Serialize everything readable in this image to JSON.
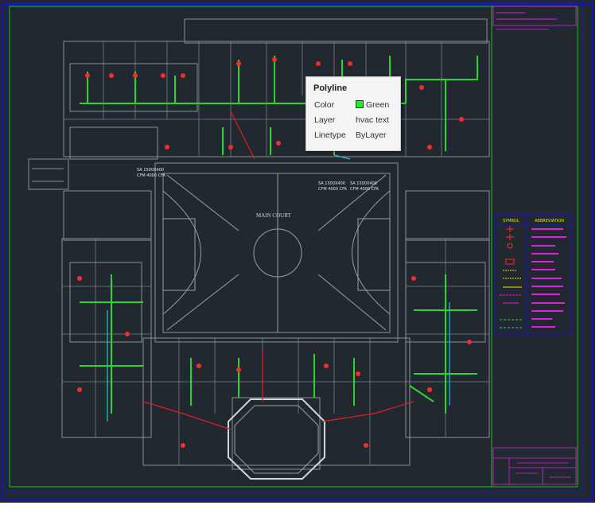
{
  "drawing": {
    "court_label": "MAIN COURT",
    "tag_a_line1": "SA 1500X400",
    "tag_a_line2": "CFM 4000 CFA",
    "tag_b_line1": "SA 1500X400",
    "tag_b_line2": "CFM 4000 CFA",
    "tag_c_line1": "SA 1500X400",
    "tag_c_line2": "CFM 4000 CFA"
  },
  "legend": {
    "header_symbol": "SYMBOL",
    "header_abbrev": "ABBREVIATION"
  },
  "tooltip": {
    "title": "Polyline",
    "color_label": "Color",
    "color_value": "Green",
    "color_hex": "#22ee22",
    "layer_label": "Layer",
    "layer_value": "hvac text",
    "linetype_label": "Linetype",
    "linetype_value": "ByLayer"
  },
  "colors": {
    "background": "#212830",
    "duct": "#2bd62b",
    "outline": "#8a8f96",
    "title_block": "#e020e0",
    "border": "#1414c8"
  }
}
